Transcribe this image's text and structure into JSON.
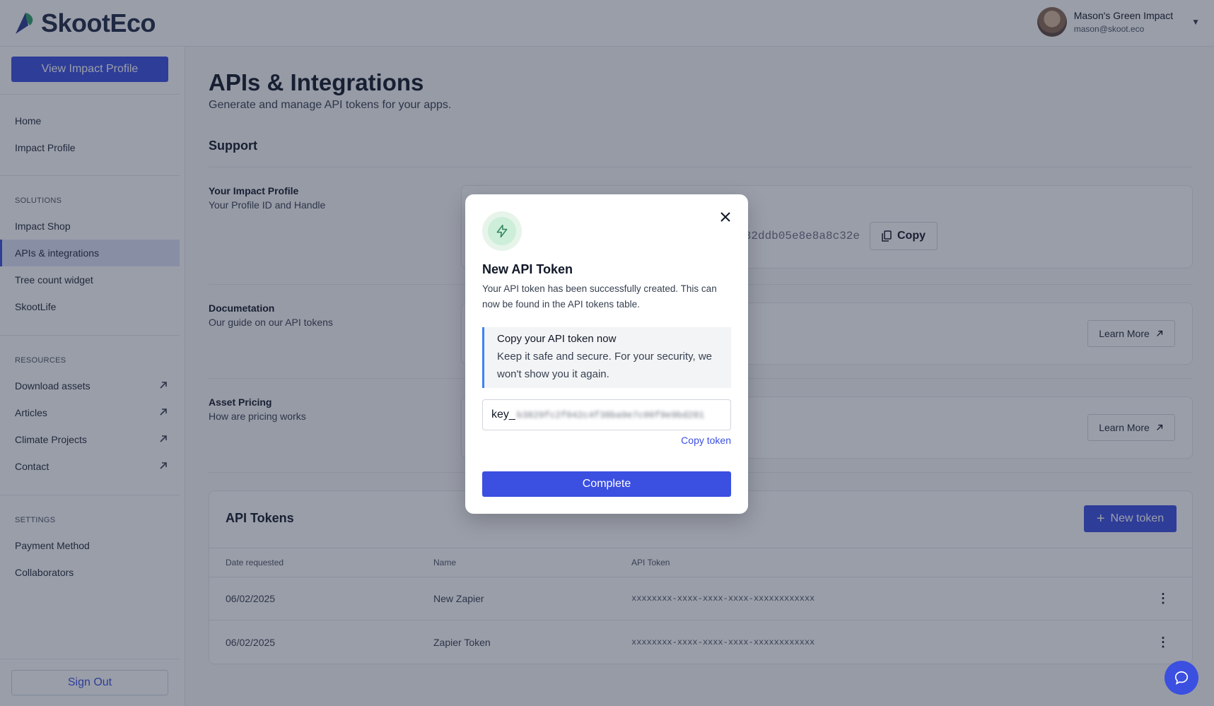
{
  "app": {
    "logo_text": "SkootEco"
  },
  "user": {
    "name": "Mason's Green Impact",
    "email": "mason@skoot.eco"
  },
  "sidebar": {
    "view_profile_label": "View Impact Profile",
    "main_items": [
      {
        "label": "Home"
      },
      {
        "label": "Impact Profile"
      }
    ],
    "solutions_heading": "SOLUTIONS",
    "solutions_items": [
      {
        "label": "Impact Shop"
      },
      {
        "label": "APIs & integrations",
        "active": true
      },
      {
        "label": "Tree count widget"
      },
      {
        "label": "SkootLife"
      }
    ],
    "resources_heading": "RESOURCES",
    "resources_items": [
      {
        "label": "Download assets",
        "icon": "external-arrow-icon"
      },
      {
        "label": "Articles",
        "icon": "external-arrow-icon"
      },
      {
        "label": "Climate Projects",
        "icon": "external-arrow-icon"
      },
      {
        "label": "Contact",
        "icon": "external-arrow-icon"
      }
    ],
    "settings_heading": "SETTINGS",
    "settings_items": [
      {
        "label": "Payment Method"
      },
      {
        "label": "Collaborators"
      }
    ],
    "sign_out_label": "Sign Out"
  },
  "main": {
    "title": "APIs & Integrations",
    "subtitle": "Generate and manage API tokens for your apps.",
    "support_heading": "Support",
    "impact_profile": {
      "label": "Your Impact Profile",
      "desc": "Your Profile ID and Handle",
      "id_value": "32ddb05e8e8a8c32e",
      "copy_label": "Copy"
    },
    "documentation": {
      "label": "Documetation",
      "desc": "Our guide on our API tokens",
      "button_label": "Learn More"
    },
    "asset_pricing": {
      "label": "Asset Pricing",
      "desc": "How are pricing works",
      "button_label": "Learn More"
    },
    "tokens": {
      "title": "API Tokens",
      "new_token_label": "New token",
      "columns": [
        "Date requested",
        "Name",
        "API Token"
      ],
      "rows": [
        {
          "date": "06/02/2025",
          "name": "New Zapier",
          "token": "xxxxxxxx-xxxx-xxxx-xxxx-xxxxxxxxxxxx"
        },
        {
          "date": "06/02/2025",
          "name": "Zapier Token",
          "token": "xxxxxxxx-xxxx-xxxx-xxxx-xxxxxxxxxxxx"
        }
      ]
    }
  },
  "modal": {
    "title": "New API Token",
    "description": "Your API token has been successfully created. This can now be found in the API tokens table.",
    "callout_title": "Copy your API token now",
    "callout_body": "Keep it safe and secure. For your security, we won't show you it again.",
    "token_prefix": "key_",
    "token_masked": "b3829fc2f042c4f38ba9e7c00f9e9bd281",
    "copy_token_label": "Copy token",
    "complete_label": "Complete"
  },
  "colors": {
    "primary": "#3b4fe0",
    "success_icon": "#2f855a"
  }
}
